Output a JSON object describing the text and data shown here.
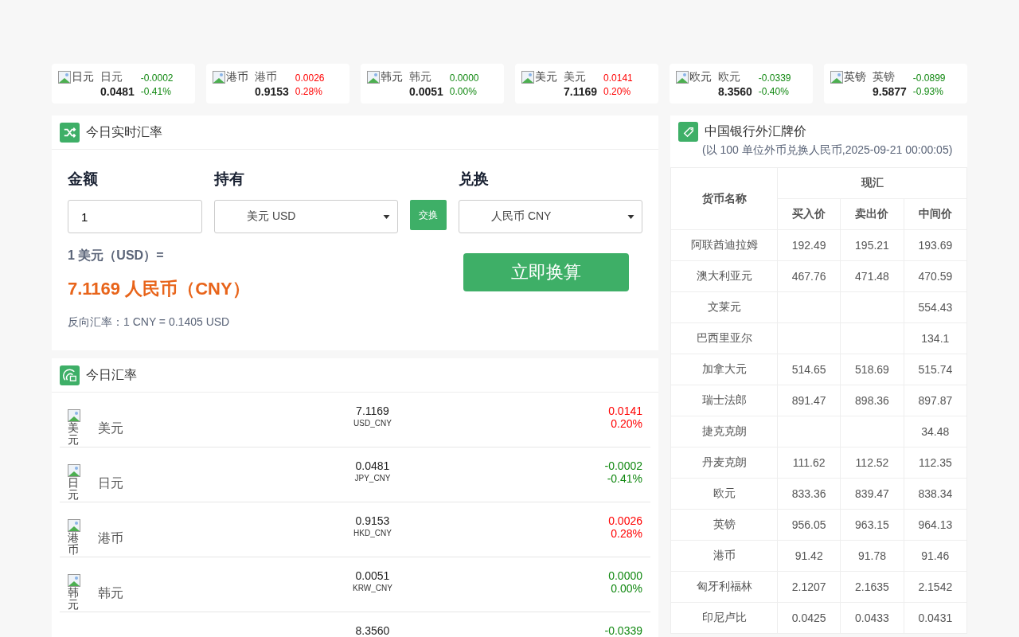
{
  "ticker": [
    {
      "icon_alt": "日元",
      "name": "日元",
      "rate": "0.0481",
      "change": "-0.0002",
      "percent": "-0.41%",
      "rising": false
    },
    {
      "icon_alt": "港币",
      "name": "港币",
      "rate": "0.9153",
      "change": "0.0026",
      "percent": "0.28%",
      "rising": true
    },
    {
      "icon_alt": "韩元",
      "name": "韩元",
      "rate": "0.0051",
      "change": "0.0000",
      "percent": "0.00%",
      "rising": false
    },
    {
      "icon_alt": "美元",
      "name": "美元",
      "rate": "7.1169",
      "change": "0.0141",
      "percent": "0.20%",
      "rising": true
    },
    {
      "icon_alt": "欧元",
      "name": "欧元",
      "rate": "8.3560",
      "change": "-0.0339",
      "percent": "-0.40%",
      "rising": false
    },
    {
      "icon_alt": "英镑",
      "name": "英镑",
      "rate": "9.5877",
      "change": "-0.0899",
      "percent": "-0.93%",
      "rising": false
    }
  ],
  "converter": {
    "title": "今日实时汇率",
    "amount_label": "金额",
    "hold_label": "持有",
    "convert_label": "兑换",
    "amount": "1",
    "hold": "美元 USD",
    "swap": "交换",
    "target": "人民币 CNY",
    "calc_button": "立即换算",
    "equation": "1 美元（USD）=",
    "result": "7.1169 人民币（CNY）",
    "reverse": "反向汇率：1 CNY = 0.1405 USD"
  },
  "rates": {
    "title": "今日汇率",
    "rows": [
      {
        "icon_alt": "美元",
        "name": "美元",
        "rate": "7.1169",
        "code": "USD_CNY",
        "change": "0.0141",
        "percent": "0.20%",
        "rising": true
      },
      {
        "icon_alt": "日元",
        "name": "日元",
        "rate": "0.0481",
        "code": "JPY_CNY",
        "change": "-0.0002",
        "percent": "-0.41%",
        "rising": false
      },
      {
        "icon_alt": "港币",
        "name": "港币",
        "rate": "0.9153",
        "code": "HKD_CNY",
        "change": "0.0026",
        "percent": "0.28%",
        "rising": true
      },
      {
        "icon_alt": "韩元",
        "name": "韩元",
        "rate": "0.0051",
        "code": "KRW_CNY",
        "change": "0.0000",
        "percent": "0.00%",
        "rising": false
      },
      {
        "rate": "8.3560",
        "change": "-0.0339",
        "rising": false
      }
    ]
  },
  "boc": {
    "title": "中国银行外汇牌价",
    "subtitle": "(以 100 单位外币兑换人民币,2025-09-21 00:00:05)",
    "header_rows": [
      [
        {
          "text": "货币名称",
          "rowspan": 2
        },
        {
          "text": "现汇",
          "colspan": 3
        }
      ],
      [
        {
          "text": "买入价"
        },
        {
          "text": "卖出价"
        },
        {
          "text": "中间价"
        }
      ]
    ],
    "rows": [
      [
        "阿联酋迪拉姆",
        "192.49",
        "195.21",
        "193.69"
      ],
      [
        "澳大利亚元",
        "467.76",
        "471.48",
        "470.59"
      ],
      [
        "文莱元",
        "",
        "",
        "554.43"
      ],
      [
        "巴西里亚尔",
        "",
        "",
        "134.1"
      ],
      [
        "加拿大元",
        "514.65",
        "518.69",
        "515.74"
      ],
      [
        "瑞士法郎",
        "891.47",
        "898.36",
        "897.87"
      ],
      [
        "捷克克朗",
        "",
        "",
        "34.48"
      ],
      [
        "丹麦克朗",
        "111.62",
        "112.52",
        "112.35"
      ],
      [
        "欧元",
        "833.36",
        "839.47",
        "838.34"
      ],
      [
        "英镑",
        "956.05",
        "963.15",
        "964.13"
      ],
      [
        "港币",
        "91.42",
        "91.78",
        "91.46"
      ],
      [
        "匈牙利福林",
        "2.1207",
        "2.1635",
        "2.1542"
      ],
      [
        "印尼卢比",
        "0.0425",
        "0.0433",
        "0.0431"
      ]
    ]
  }
}
